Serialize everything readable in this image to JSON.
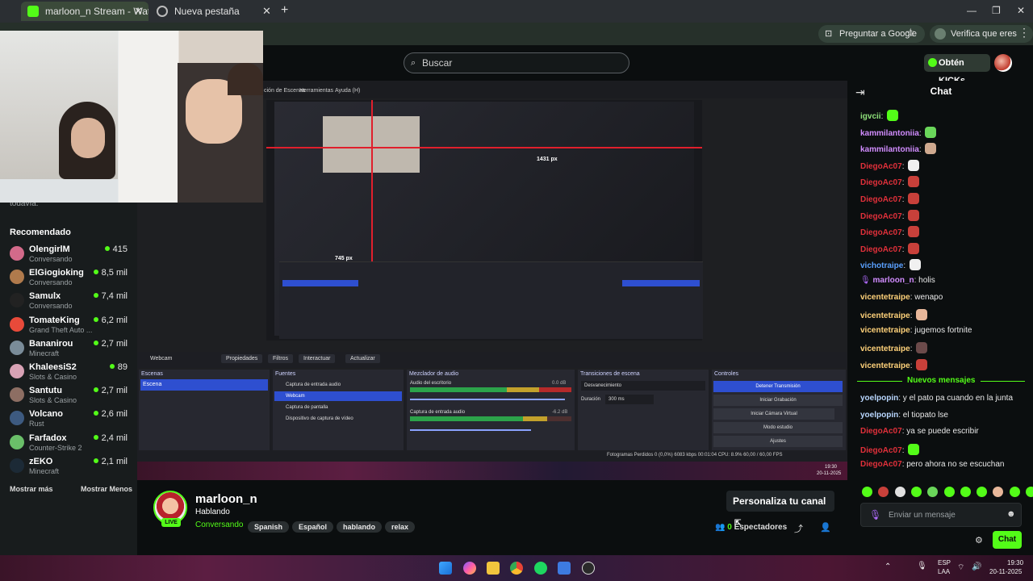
{
  "browser": {
    "tabs": [
      {
        "label": "marloon_n Stream - Watch Live",
        "active": true
      },
      {
        "label": "Nueva pestaña",
        "active": false
      }
    ],
    "new_tab": "+",
    "ask_google": "Preguntar a Google",
    "verify": "Verifica que eres tú",
    "window_controls": [
      "—",
      "❐",
      "✕"
    ]
  },
  "header": {
    "search_placeholder": "Buscar",
    "get_kicks": "Obtén KICKs"
  },
  "sidebar": {
    "not_following": "No estás siguiendo ningún canal todavía.",
    "recommended_title": "Recomendado",
    "items": [
      {
        "name": "OlengirlM",
        "category": "Conversando",
        "viewers": "415",
        "color": "#d36a8a"
      },
      {
        "name": "ElGiogioking",
        "category": "Conversando",
        "viewers": "8,5 mil",
        "color": "#b07a4c"
      },
      {
        "name": "Samulx",
        "category": "Conversando",
        "viewers": "7,4 mil",
        "color": "#222222"
      },
      {
        "name": "TomateKing",
        "category": "Grand Theft Auto ...",
        "viewers": "6,2 mil",
        "color": "#e84a3a"
      },
      {
        "name": "Bananirou",
        "category": "Minecraft",
        "viewers": "2,7 mil",
        "color": "#7a8c99"
      },
      {
        "name": "KhaleesiS2",
        "category": "Slots & Casino",
        "viewers": "89",
        "color": "#d8a2b5"
      },
      {
        "name": "Santutu",
        "category": "Slots & Casino",
        "viewers": "2,7 mil",
        "color": "#8d6e63"
      },
      {
        "name": "Volcano",
        "category": "Rust",
        "viewers": "2,6 mil",
        "color": "#3d5a80"
      },
      {
        "name": "Farfadox",
        "category": "Counter-Strike 2",
        "viewers": "2,4 mil",
        "color": "#6abf69"
      },
      {
        "name": "zEKO",
        "category": "Minecraft",
        "viewers": "2,1 mil",
        "color": "#1c2a36"
      }
    ],
    "show_more": "Mostrar más",
    "show_less": "Mostrar Menos"
  },
  "stream": {
    "channel": "marloon_n",
    "title": "Hablando",
    "category": "Conversando",
    "live_badge": "LIVE",
    "tags": [
      "Spanish",
      "Español",
      "hablando",
      "relax"
    ],
    "customize": "Personaliza tu canal",
    "viewers": "0",
    "viewers_label": "Espectadores"
  },
  "obs": {
    "menu": [
      "ción de Escenas",
      "Herramientas",
      "Ayuda (H)"
    ],
    "measure_a": "1431 px",
    "measure_b": "745 px",
    "source_toolbar": [
      "Webcam",
      "Propiedades",
      "Filtros",
      "Interactuar",
      "Actualizar"
    ],
    "panels": [
      "Escenas",
      "Fuentes",
      "Mezclador de audio",
      "Transiciones de escena",
      "Controles"
    ],
    "scene": "Escena",
    "sources": [
      "Captura de entrada audio",
      "Webcam",
      "Captura de pantalla",
      "Dispositivo de captura de vídeo"
    ],
    "mixer": [
      "Audio del escritorio",
      "Captura de entrada audio"
    ],
    "mixer_db": [
      "0.0 dB",
      "-6.2 dB"
    ],
    "transition": "Desvanecimiento",
    "duration_label": "Duración",
    "duration": "300 ms",
    "controls": [
      "Detener Transmisión",
      "Iniciar Grabación",
      "Iniciar Cámara Virtual",
      "Modo estudio",
      "Ajustes"
    ],
    "status": "Fotogramas Perdidos 0 (0,0%)   6083 kbps   00:01:04   CPU: 8.9%   60,00 / 60,00 FPS",
    "clock": "19:30",
    "date": "20-11-2025"
  },
  "chat": {
    "title": "Chat",
    "messages": [
      {
        "user": "igvcii",
        "color": "#8ee07a",
        "text": "",
        "emote": "#53fc18"
      },
      {
        "user": "kammilantoniia",
        "color": "#d18cff",
        "text": "",
        "emote": "#6ad65a"
      },
      {
        "user": "kammilantoniia",
        "color": "#d18cff",
        "text": "",
        "emote": "#cfa98f"
      },
      {
        "user": "DiegoAc07",
        "color": "#e0303a",
        "text": "",
        "emote": "#f0f0f0"
      },
      {
        "user": "DiegoAc07",
        "color": "#e0303a",
        "text": "",
        "emote": "#c8403a"
      },
      {
        "user": "DiegoAc07",
        "color": "#e0303a",
        "text": "",
        "emote": "#c8403a"
      },
      {
        "user": "DiegoAc07",
        "color": "#e0303a",
        "text": "",
        "emote": "#c8403a"
      },
      {
        "user": "DiegoAc07",
        "color": "#e0303a",
        "text": "",
        "emote": "#c8403a"
      },
      {
        "user": "DiegoAc07",
        "color": "#e0303a",
        "text": "",
        "emote": "#c8403a"
      },
      {
        "user": "vichotraipe",
        "color": "#5aa0ff",
        "text": "",
        "emote": "#f0f0f0"
      },
      {
        "user": "marloon_n",
        "color": "#d18cff",
        "text": "holis",
        "emote": ""
      },
      {
        "user": "vicentetraipe",
        "color": "#ffd27a",
        "text": "wenapo",
        "emote": ""
      },
      {
        "user": "vicentetraipe",
        "color": "#ffd27a",
        "text": "",
        "emote": "#e8b79a"
      },
      {
        "user": "vicentetraipe",
        "color": "#ffd27a",
        "text": "jugemos fortnite",
        "emote": ""
      },
      {
        "user": "vicentetraipe",
        "color": "#ffd27a",
        "text": "",
        "emote": "#6b4a4a"
      },
      {
        "user": "vicentetraipe",
        "color": "#ffd27a",
        "text": "",
        "emote": "#c8403a"
      }
    ],
    "new_messages": "Nuevos mensajes",
    "new": [
      {
        "user": "yoelpopin",
        "color": "#b9d7ff",
        "text": "y el pato pa cuando en la junta",
        "emote": ""
      },
      {
        "user": "yoelpopin",
        "color": "#b9d7ff",
        "text": "el tiopato lse",
        "emote": ""
      },
      {
        "user": "DiegoAc07",
        "color": "#e0303a",
        "text": "ya se puede escribir",
        "emote": ""
      },
      {
        "user": "DiegoAc07",
        "color": "#e0303a",
        "text": "",
        "emote": "#53fc18"
      },
      {
        "user": "DiegoAc07",
        "color": "#e0303a",
        "text": "pero ahora no se escuchan",
        "emote": ""
      }
    ],
    "emote_bar": [
      "#53fc18",
      "#c8403a",
      "#e0e0e0",
      "#53fc18",
      "#6ad65a",
      "#53fc18",
      "#53fc18",
      "#53fc18",
      "#e8b79a",
      "#53fc18",
      "#53fc18"
    ],
    "input_placeholder": "Enviar un mensaje",
    "send": "Chat"
  },
  "system": {
    "lang": "ESP",
    "region": "LAA",
    "time": "19:30",
    "date": "20-11-2025"
  },
  "colors": {
    "kick_green": "#53fc18",
    "obs_blue": "#2e4fd0"
  }
}
